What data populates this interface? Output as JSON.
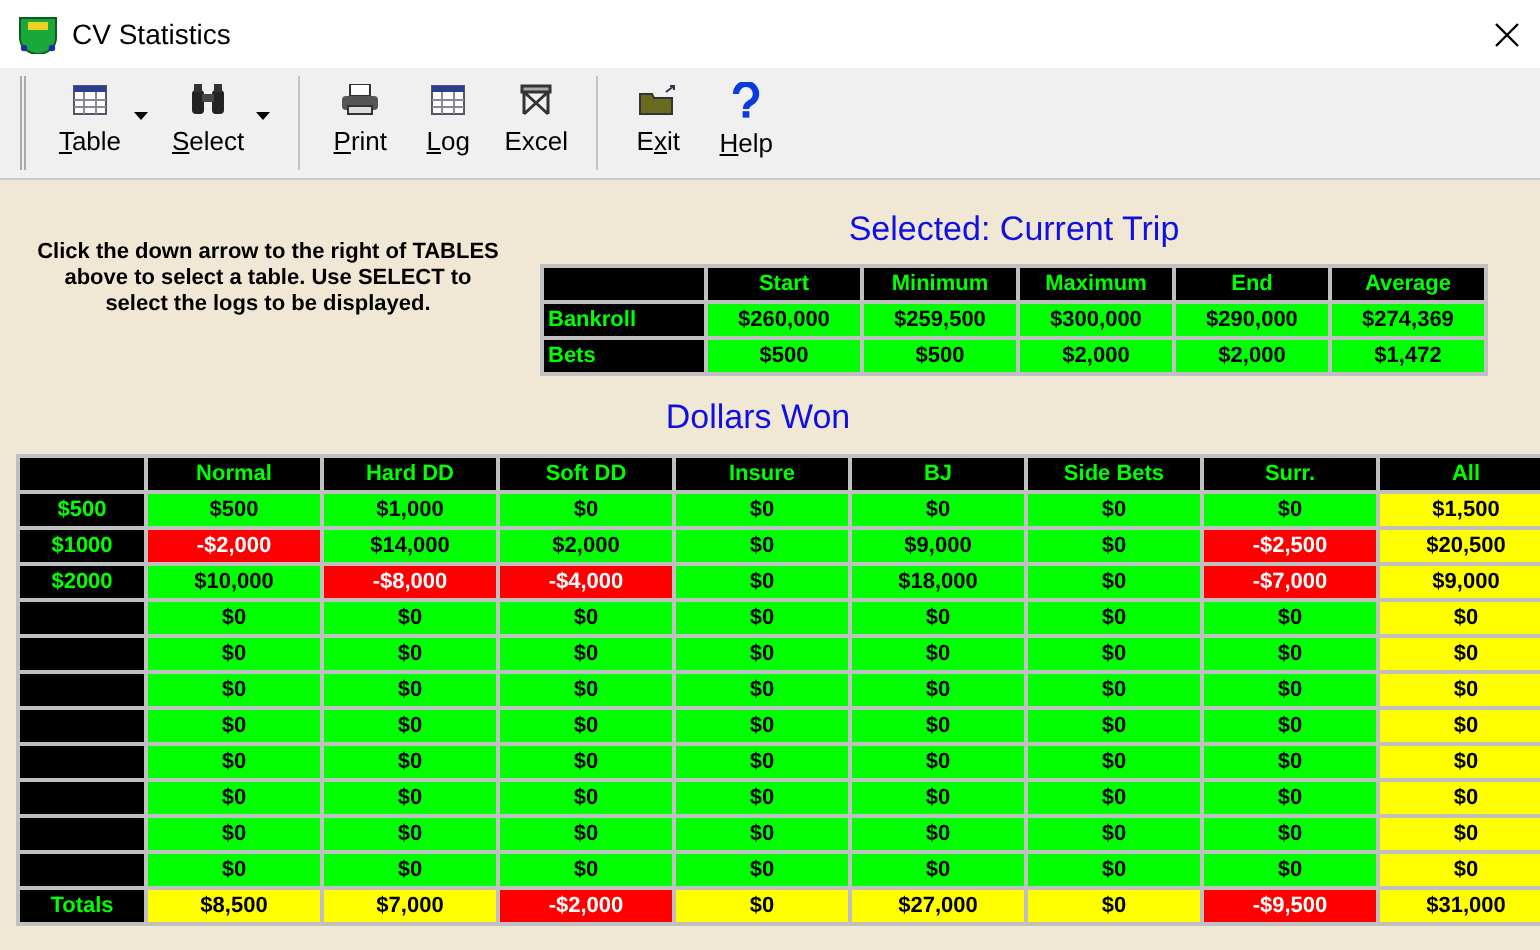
{
  "window": {
    "title": "CV Statistics"
  },
  "toolbar": {
    "groups": [
      [
        {
          "kind": "dropdown",
          "label": [
            {
              "text": "T",
              "underline": true
            },
            {
              "text": "able",
              "underline": false
            }
          ]
        },
        {
          "kind": "dropdown",
          "label": [
            {
              "text": "S",
              "underline": true
            },
            {
              "text": "elect",
              "underline": false
            }
          ]
        }
      ],
      [
        {
          "kind": "button",
          "label": [
            {
              "text": "P",
              "underline": true
            },
            {
              "text": "rint",
              "underline": false
            }
          ]
        },
        {
          "kind": "button",
          "label": [
            {
              "text": "L",
              "underline": true
            },
            {
              "text": "og",
              "underline": false
            }
          ]
        },
        {
          "kind": "button",
          "label": [
            {
              "text": "Excel",
              "underline": false
            }
          ]
        }
      ],
      [
        {
          "kind": "button",
          "label": [
            {
              "text": "E",
              "underline": false
            },
            {
              "text": "x",
              "underline": true
            },
            {
              "text": "it",
              "underline": false
            }
          ]
        },
        {
          "kind": "button",
          "label": [
            {
              "text": "H",
              "underline": true
            },
            {
              "text": "elp",
              "underline": false
            }
          ]
        }
      ]
    ]
  },
  "instructions": "Click the down arrow to the right of TABLES above to select a table. Use SELECT to select the logs to be displayed.",
  "summary": {
    "title": "Selected: Current Trip",
    "columns": [
      "Start",
      "Minimum",
      "Maximum",
      "End",
      "Average"
    ],
    "rows": [
      {
        "label": "Bankroll",
        "cells": [
          "$260,000",
          "$259,500",
          "$300,000",
          "$290,000",
          "$274,369"
        ]
      },
      {
        "label": "Bets",
        "cells": [
          "$500",
          "$500",
          "$2,000",
          "$2,000",
          "$1,472"
        ]
      }
    ]
  },
  "dollars_won": {
    "title": "Dollars Won",
    "columns": [
      "Normal",
      "Hard DD",
      "Soft DD",
      "Insure",
      "BJ",
      "Side Bets",
      "Surr.",
      "All"
    ],
    "rows": [
      {
        "label": "$500",
        "cells": [
          {
            "text": "$500",
            "color": "#00ff00"
          },
          {
            "text": "$1,000",
            "color": "#00ff00"
          },
          {
            "text": "$0",
            "color": "#00ff00"
          },
          {
            "text": "$0",
            "color": "#00ff00"
          },
          {
            "text": "$0",
            "color": "#00ff00"
          },
          {
            "text": "$0",
            "color": "#00ff00"
          },
          {
            "text": "$0",
            "color": "#00ff00"
          },
          {
            "text": "$1,500",
            "color": "#ffff00"
          }
        ]
      },
      {
        "label": "$1000",
        "cells": [
          {
            "text": "-$2,000",
            "color": "#ff0000"
          },
          {
            "text": "$14,000",
            "color": "#00ff00"
          },
          {
            "text": "$2,000",
            "color": "#00ff00"
          },
          {
            "text": "$0",
            "color": "#00ff00"
          },
          {
            "text": "$9,000",
            "color": "#00ff00"
          },
          {
            "text": "$0",
            "color": "#00ff00"
          },
          {
            "text": "-$2,500",
            "color": "#ff0000"
          },
          {
            "text": "$20,500",
            "color": "#ffff00"
          }
        ]
      },
      {
        "label": "$2000",
        "cells": [
          {
            "text": "$10,000",
            "color": "#00ff00"
          },
          {
            "text": "-$8,000",
            "color": "#ff0000"
          },
          {
            "text": "-$4,000",
            "color": "#ff0000"
          },
          {
            "text": "$0",
            "color": "#00ff00"
          },
          {
            "text": "$18,000",
            "color": "#00ff00"
          },
          {
            "text": "$0",
            "color": "#00ff00"
          },
          {
            "text": "-$7,000",
            "color": "#ff0000"
          },
          {
            "text": "$9,000",
            "color": "#ffff00"
          }
        ]
      },
      {
        "cells": [
          {
            "text": "$0",
            "color": "#00ff00"
          },
          {
            "text": "$0",
            "color": "#00ff00"
          },
          {
            "text": "$0",
            "color": "#00ff00"
          },
          {
            "text": "$0",
            "color": "#00ff00"
          },
          {
            "text": "$0",
            "color": "#00ff00"
          },
          {
            "text": "$0",
            "color": "#00ff00"
          },
          {
            "text": "$0",
            "color": "#00ff00"
          },
          {
            "text": "$0",
            "color": "#ffff00"
          }
        ]
      },
      {
        "cells": [
          {
            "text": "$0",
            "color": "#00ff00"
          },
          {
            "text": "$0",
            "color": "#00ff00"
          },
          {
            "text": "$0",
            "color": "#00ff00"
          },
          {
            "text": "$0",
            "color": "#00ff00"
          },
          {
            "text": "$0",
            "color": "#00ff00"
          },
          {
            "text": "$0",
            "color": "#00ff00"
          },
          {
            "text": "$0",
            "color": "#00ff00"
          },
          {
            "text": "$0",
            "color": "#ffff00"
          }
        ]
      },
      {
        "cells": [
          {
            "text": "$0",
            "color": "#00ff00"
          },
          {
            "text": "$0",
            "color": "#00ff00"
          },
          {
            "text": "$0",
            "color": "#00ff00"
          },
          {
            "text": "$0",
            "color": "#00ff00"
          },
          {
            "text": "$0",
            "color": "#00ff00"
          },
          {
            "text": "$0",
            "color": "#00ff00"
          },
          {
            "text": "$0",
            "color": "#00ff00"
          },
          {
            "text": "$0",
            "color": "#ffff00"
          }
        ]
      },
      {
        "cells": [
          {
            "text": "$0",
            "color": "#00ff00"
          },
          {
            "text": "$0",
            "color": "#00ff00"
          },
          {
            "text": "$0",
            "color": "#00ff00"
          },
          {
            "text": "$0",
            "color": "#00ff00"
          },
          {
            "text": "$0",
            "color": "#00ff00"
          },
          {
            "text": "$0",
            "color": "#00ff00"
          },
          {
            "text": "$0",
            "color": "#00ff00"
          },
          {
            "text": "$0",
            "color": "#ffff00"
          }
        ]
      },
      {
        "cells": [
          {
            "text": "$0",
            "color": "#00ff00"
          },
          {
            "text": "$0",
            "color": "#00ff00"
          },
          {
            "text": "$0",
            "color": "#00ff00"
          },
          {
            "text": "$0",
            "color": "#00ff00"
          },
          {
            "text": "$0",
            "color": "#00ff00"
          },
          {
            "text": "$0",
            "color": "#00ff00"
          },
          {
            "text": "$0",
            "color": "#00ff00"
          },
          {
            "text": "$0",
            "color": "#ffff00"
          }
        ]
      },
      {
        "cells": [
          {
            "text": "$0",
            "color": "#00ff00"
          },
          {
            "text": "$0",
            "color": "#00ff00"
          },
          {
            "text": "$0",
            "color": "#00ff00"
          },
          {
            "text": "$0",
            "color": "#00ff00"
          },
          {
            "text": "$0",
            "color": "#00ff00"
          },
          {
            "text": "$0",
            "color": "#00ff00"
          },
          {
            "text": "$0",
            "color": "#00ff00"
          },
          {
            "text": "$0",
            "color": "#ffff00"
          }
        ]
      },
      {
        "cells": [
          {
            "text": "$0",
            "color": "#00ff00"
          },
          {
            "text": "$0",
            "color": "#00ff00"
          },
          {
            "text": "$0",
            "color": "#00ff00"
          },
          {
            "text": "$0",
            "color": "#00ff00"
          },
          {
            "text": "$0",
            "color": "#00ff00"
          },
          {
            "text": "$0",
            "color": "#00ff00"
          },
          {
            "text": "$0",
            "color": "#00ff00"
          },
          {
            "text": "$0",
            "color": "#ffff00"
          }
        ]
      },
      {
        "cells": [
          {
            "text": "$0",
            "color": "#00ff00"
          },
          {
            "text": "$0",
            "color": "#00ff00"
          },
          {
            "text": "$0",
            "color": "#00ff00"
          },
          {
            "text": "$0",
            "color": "#00ff00"
          },
          {
            "text": "$0",
            "color": "#00ff00"
          },
          {
            "text": "$0",
            "color": "#00ff00"
          },
          {
            "text": "$0",
            "color": "#00ff00"
          },
          {
            "text": "$0",
            "color": "#ffff00"
          }
        ]
      },
      {
        "label": "Totals",
        "cells": [
          {
            "text": "$8,500",
            "color": "#ffff00"
          },
          {
            "text": "$7,000",
            "color": "#ffff00"
          },
          {
            "text": "-$2,000",
            "color": "#ff0000"
          },
          {
            "text": "$0",
            "color": "#ffff00"
          },
          {
            "text": "$27,000",
            "color": "#ffff00"
          },
          {
            "text": "$0",
            "color": "#ffff00"
          },
          {
            "text": "-$9,500",
            "color": "#ff0000"
          },
          {
            "text": "$31,000",
            "color": "#ffff00"
          }
        ]
      }
    ]
  }
}
